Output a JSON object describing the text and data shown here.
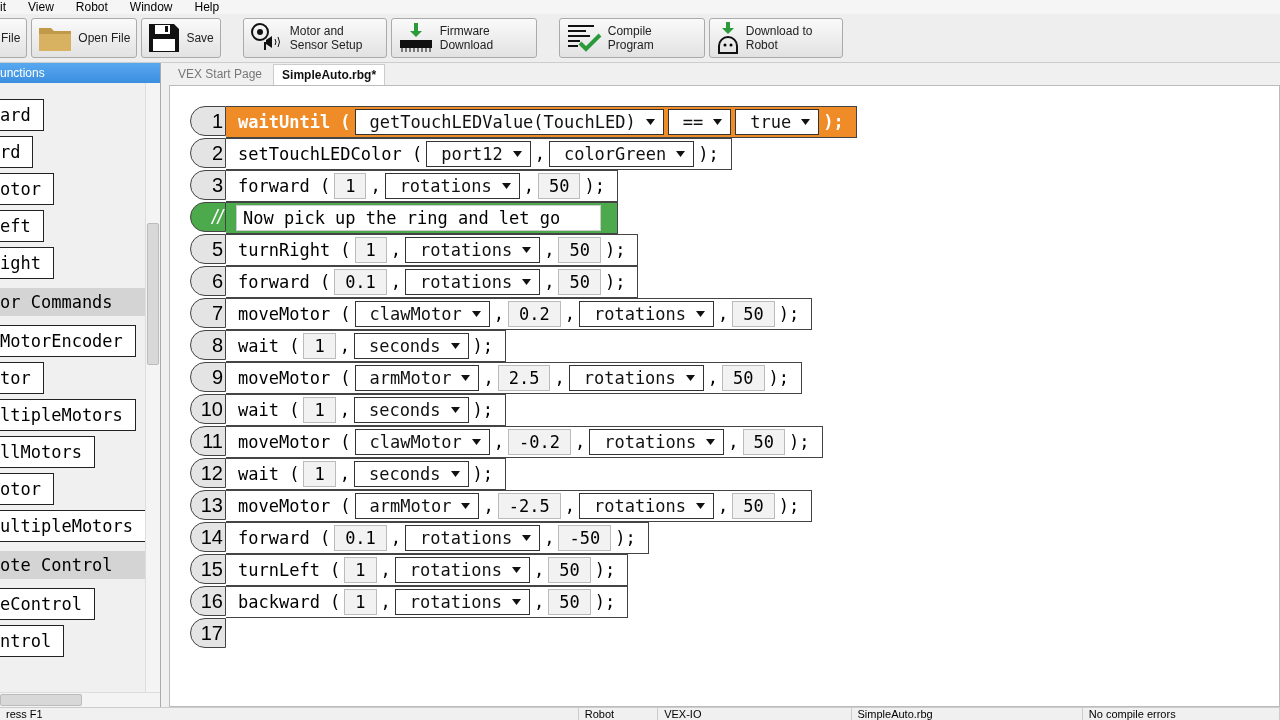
{
  "menu": [
    "it",
    "View",
    "Robot",
    "Window",
    "Help"
  ],
  "toolbar": [
    {
      "label": "File",
      "kind": "plain"
    },
    {
      "label": "Open File",
      "kind": "folder"
    },
    {
      "label": "Save",
      "kind": "disk"
    },
    {
      "label": "Motor and Sensor Setup",
      "kind": "motor"
    },
    {
      "label": "Firmware Download",
      "kind": "chip"
    },
    {
      "label": "Compile Program",
      "kind": "compile"
    },
    {
      "label": "Download to Robot",
      "kind": "robot"
    }
  ],
  "sidebar": {
    "title": "unctions",
    "items": [
      {
        "kind": "block",
        "label": "ard"
      },
      {
        "kind": "block",
        "label": "rd"
      },
      {
        "kind": "block",
        "label": "otor"
      },
      {
        "kind": "block",
        "label": "eft"
      },
      {
        "kind": "block",
        "label": "ight"
      },
      {
        "kind": "category",
        "label": "or Commands"
      },
      {
        "kind": "block",
        "label": "MotorEncoder"
      },
      {
        "kind": "block",
        "label": "tor"
      },
      {
        "kind": "block",
        "label": "ltipleMotors"
      },
      {
        "kind": "block",
        "label": "llMotors"
      },
      {
        "kind": "block",
        "label": "otor"
      },
      {
        "kind": "block",
        "label": "ultipleMotors"
      },
      {
        "kind": "category",
        "label": "ote Control"
      },
      {
        "kind": "block",
        "label": "eControl"
      },
      {
        "kind": "block",
        "label": "ntrol"
      }
    ]
  },
  "tabs": [
    {
      "label": "VEX Start Page",
      "selected": false
    },
    {
      "label": "SimpleAuto.rbg*",
      "selected": true
    }
  ],
  "lines": [
    {
      "number": "1",
      "kind": "highlight",
      "parts": [
        {
          "kind": "text",
          "text": "waitUntil ("
        },
        {
          "kind": "dropdown",
          "text": "getTouchLEDValue(TouchLED)"
        },
        {
          "kind": "dropdown",
          "text": "=="
        },
        {
          "kind": "dropdown",
          "text": "true"
        },
        {
          "kind": "text",
          "text": ");"
        }
      ]
    },
    {
      "number": "2",
      "kind": "normal",
      "parts": [
        {
          "kind": "text",
          "text": "setTouchLEDColor ("
        },
        {
          "kind": "dropdown",
          "text": "port12"
        },
        {
          "kind": "text",
          "text": ","
        },
        {
          "kind": "dropdown",
          "text": "colorGreen"
        },
        {
          "kind": "text",
          "text": ");"
        }
      ]
    },
    {
      "number": "3",
      "kind": "normal",
      "parts": [
        {
          "kind": "text",
          "text": "forward ("
        },
        {
          "kind": "field",
          "text": "1"
        },
        {
          "kind": "text",
          "text": ","
        },
        {
          "kind": "dropdown",
          "text": "rotations"
        },
        {
          "kind": "text",
          "text": ","
        },
        {
          "kind": "field",
          "text": "50"
        },
        {
          "kind": "text",
          "text": ");"
        }
      ]
    },
    {
      "number": "//",
      "kind": "comment",
      "parts": [
        {
          "kind": "comment",
          "text": "Now pick up the ring and let go"
        }
      ]
    },
    {
      "number": "5",
      "kind": "normal",
      "parts": [
        {
          "kind": "text",
          "text": "turnRight ("
        },
        {
          "kind": "field",
          "text": "1"
        },
        {
          "kind": "text",
          "text": ","
        },
        {
          "kind": "dropdown",
          "text": "rotations"
        },
        {
          "kind": "text",
          "text": ","
        },
        {
          "kind": "field",
          "text": "50"
        },
        {
          "kind": "text",
          "text": ");"
        }
      ]
    },
    {
      "number": "6",
      "kind": "normal",
      "parts": [
        {
          "kind": "text",
          "text": "forward ("
        },
        {
          "kind": "field",
          "text": "0.1"
        },
        {
          "kind": "text",
          "text": ","
        },
        {
          "kind": "dropdown",
          "text": "rotations"
        },
        {
          "kind": "text",
          "text": ","
        },
        {
          "kind": "field",
          "text": "50"
        },
        {
          "kind": "text",
          "text": ");"
        }
      ]
    },
    {
      "number": "7",
      "kind": "normal",
      "parts": [
        {
          "kind": "text",
          "text": "moveMotor ("
        },
        {
          "kind": "dropdown",
          "text": "clawMotor"
        },
        {
          "kind": "text",
          "text": ","
        },
        {
          "kind": "field",
          "text": "0.2"
        },
        {
          "kind": "text",
          "text": ","
        },
        {
          "kind": "dropdown",
          "text": "rotations"
        },
        {
          "kind": "text",
          "text": ","
        },
        {
          "kind": "field",
          "text": "50"
        },
        {
          "kind": "text",
          "text": ");"
        }
      ]
    },
    {
      "number": "8",
      "kind": "normal",
      "parts": [
        {
          "kind": "text",
          "text": "wait ("
        },
        {
          "kind": "field",
          "text": "1"
        },
        {
          "kind": "text",
          "text": ","
        },
        {
          "kind": "dropdown",
          "text": "seconds"
        },
        {
          "kind": "text",
          "text": ");"
        }
      ]
    },
    {
      "number": "9",
      "kind": "normal",
      "parts": [
        {
          "kind": "text",
          "text": "moveMotor ("
        },
        {
          "kind": "dropdown",
          "text": "armMotor"
        },
        {
          "kind": "text",
          "text": ","
        },
        {
          "kind": "field",
          "text": "2.5"
        },
        {
          "kind": "text",
          "text": ","
        },
        {
          "kind": "dropdown",
          "text": "rotations"
        },
        {
          "kind": "text",
          "text": ","
        },
        {
          "kind": "field",
          "text": "50"
        },
        {
          "kind": "text",
          "text": ");"
        }
      ]
    },
    {
      "number": "10",
      "kind": "normal",
      "parts": [
        {
          "kind": "text",
          "text": "wait ("
        },
        {
          "kind": "field",
          "text": "1"
        },
        {
          "kind": "text",
          "text": ","
        },
        {
          "kind": "dropdown",
          "text": "seconds"
        },
        {
          "kind": "text",
          "text": ");"
        }
      ]
    },
    {
      "number": "11",
      "kind": "normal",
      "parts": [
        {
          "kind": "text",
          "text": "moveMotor ("
        },
        {
          "kind": "dropdown",
          "text": "clawMotor"
        },
        {
          "kind": "text",
          "text": ","
        },
        {
          "kind": "field",
          "text": "-0.2"
        },
        {
          "kind": "text",
          "text": ","
        },
        {
          "kind": "dropdown",
          "text": "rotations"
        },
        {
          "kind": "text",
          "text": ","
        },
        {
          "kind": "field",
          "text": "50"
        },
        {
          "kind": "text",
          "text": ");"
        }
      ]
    },
    {
      "number": "12",
      "kind": "normal",
      "parts": [
        {
          "kind": "text",
          "text": "wait ("
        },
        {
          "kind": "field",
          "text": "1"
        },
        {
          "kind": "text",
          "text": ","
        },
        {
          "kind": "dropdown",
          "text": "seconds"
        },
        {
          "kind": "text",
          "text": ");"
        }
      ]
    },
    {
      "number": "13",
      "kind": "normal",
      "parts": [
        {
          "kind": "text",
          "text": "moveMotor ("
        },
        {
          "kind": "dropdown",
          "text": "armMotor"
        },
        {
          "kind": "text",
          "text": ","
        },
        {
          "kind": "field",
          "text": "-2.5"
        },
        {
          "kind": "text",
          "text": ","
        },
        {
          "kind": "dropdown",
          "text": "rotations"
        },
        {
          "kind": "text",
          "text": ","
        },
        {
          "kind": "field",
          "text": "50"
        },
        {
          "kind": "text",
          "text": ");"
        }
      ]
    },
    {
      "number": "14",
      "kind": "normal",
      "parts": [
        {
          "kind": "text",
          "text": "forward ("
        },
        {
          "kind": "field",
          "text": "0.1"
        },
        {
          "kind": "text",
          "text": ","
        },
        {
          "kind": "dropdown",
          "text": "rotations"
        },
        {
          "kind": "text",
          "text": ","
        },
        {
          "kind": "field",
          "text": "-50"
        },
        {
          "kind": "text",
          "text": ");"
        }
      ]
    },
    {
      "number": "15",
      "kind": "normal",
      "parts": [
        {
          "kind": "text",
          "text": "turnLeft ("
        },
        {
          "kind": "field",
          "text": "1"
        },
        {
          "kind": "text",
          "text": ","
        },
        {
          "kind": "dropdown",
          "text": "rotations"
        },
        {
          "kind": "text",
          "text": ","
        },
        {
          "kind": "field",
          "text": "50"
        },
        {
          "kind": "text",
          "text": ");"
        }
      ]
    },
    {
      "number": "16",
      "kind": "normal",
      "parts": [
        {
          "kind": "text",
          "text": "backward ("
        },
        {
          "kind": "field",
          "text": "1"
        },
        {
          "kind": "text",
          "text": ","
        },
        {
          "kind": "dropdown",
          "text": "rotations"
        },
        {
          "kind": "text",
          "text": ","
        },
        {
          "kind": "field",
          "text": "50"
        },
        {
          "kind": "text",
          "text": ");"
        }
      ]
    },
    {
      "number": "17",
      "kind": "empty"
    }
  ],
  "status_bar": [
    "ress F1",
    "Robot",
    "VEX-IO",
    "SimpleAuto.rbg",
    "No compile errors"
  ]
}
